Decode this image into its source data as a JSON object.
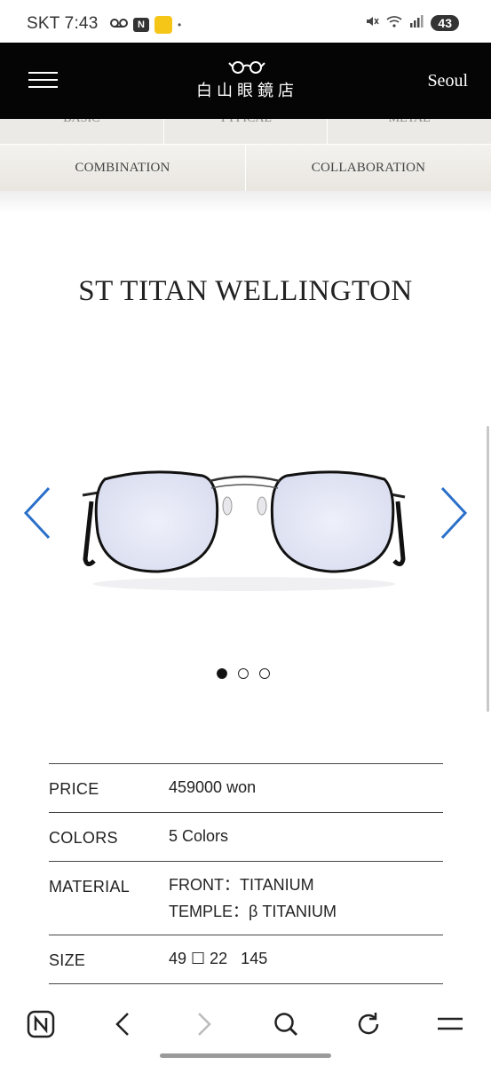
{
  "status_bar": {
    "carrier_time": "SKT 7:43",
    "n_badge": "N",
    "dot": "•",
    "battery": "43"
  },
  "header": {
    "logo_text": "白山眼鏡店",
    "city": "Seoul"
  },
  "categories": {
    "row1": [
      "BASIC",
      "TYPICAL",
      "METAL"
    ],
    "row2": [
      "COMBINATION",
      "COLLABORATION"
    ]
  },
  "product": {
    "title": "ST TITAN WELLINGTON",
    "carousel": {
      "slides": 3,
      "active": 1
    }
  },
  "specs": {
    "price": {
      "label": "PRICE",
      "value": "459000 won"
    },
    "colors": {
      "label": "COLORS",
      "value": "5 Colors"
    },
    "material": {
      "label": "MATERIAL",
      "front": "FRONT：TITANIUM",
      "temple": "TEMPLE：β TITANIUM"
    },
    "size": {
      "label": "SIZE",
      "value": "49 ☐ 22   145"
    }
  },
  "icons": {
    "menu": "hamburger-icon",
    "prev": "chevron-left-icon",
    "next": "chevron-right-icon",
    "browser": [
      "naver-home-icon",
      "back-icon",
      "forward-icon",
      "search-icon",
      "refresh-icon",
      "menu-icon"
    ]
  },
  "colors": {
    "header_bg": "#050505",
    "arrow_blue": "#2a6fc9",
    "tab_bg": "#eceae6"
  }
}
